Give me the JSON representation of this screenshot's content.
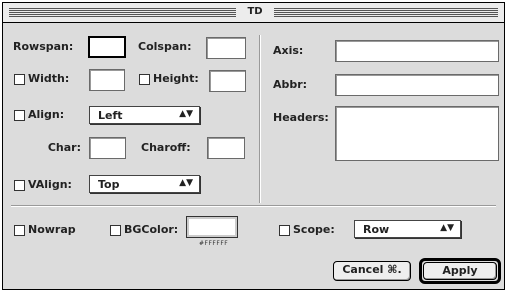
{
  "window": {
    "title": "TD"
  },
  "left": {
    "rowspan": {
      "label": "Rowspan:",
      "value": ""
    },
    "colspan": {
      "label": "Colspan:",
      "value": ""
    },
    "width": {
      "label": "Width:",
      "value": "",
      "checked": false
    },
    "height": {
      "label": "Height:",
      "value": "",
      "checked": false
    },
    "align": {
      "label": "Align:",
      "selected": "Left",
      "checked": false
    },
    "char": {
      "label": "Char:",
      "value": ""
    },
    "charoff": {
      "label": "Charoff:",
      "value": ""
    },
    "valign": {
      "label": "VAlign:",
      "selected": "Top",
      "checked": false
    }
  },
  "right": {
    "axis": {
      "label": "Axis:",
      "value": ""
    },
    "abbr": {
      "label": "Abbr:",
      "value": ""
    },
    "headers": {
      "label": "Headers:",
      "value": ""
    }
  },
  "bottom": {
    "nowrap": {
      "label": "Nowrap",
      "checked": false
    },
    "bgcolor": {
      "label": "BGColor:",
      "swatch": "#ffffff",
      "hex": "#FFFFFF",
      "checked": false
    },
    "scope": {
      "label": "Scope:",
      "selected": "Row",
      "checked": false
    }
  },
  "buttons": {
    "cancel": "Cancel ⌘.",
    "apply": "Apply"
  },
  "icons": {
    "popup_arrow": "updown-arrows-icon"
  }
}
